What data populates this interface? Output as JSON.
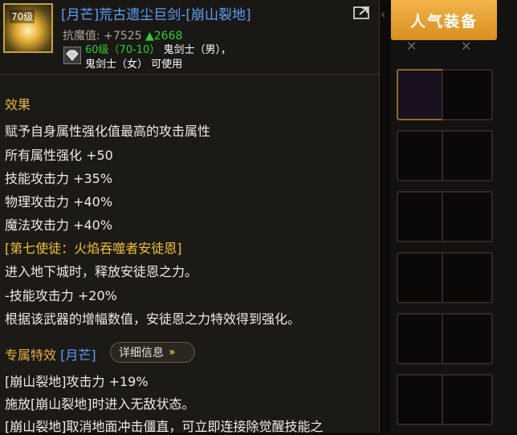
{
  "item": {
    "level_badge": "70级",
    "name": "[月芒]荒古遗尘巨剑-[崩山裂地]",
    "stat_label": "抗魔值: +7525",
    "stat_delta": "▲2668",
    "req_level": "60级（70-10）",
    "req_class_1": "鬼剑士（男），",
    "req_class_2": "鬼剑士（女） 可使用"
  },
  "effect": {
    "title": "效果",
    "lines": [
      "赋予自身属性强化值最高的攻击属性",
      "所有属性强化 +50",
      "技能攻击力 +35%",
      "物理攻击力 +40%",
      "魔法攻击力 +40%"
    ],
    "apostle_title": "[第七使徒：火焰吞噬者安徒恩]",
    "apostle_lines": [
      "进入地下城时，释放安徒恩之力。",
      "-技能攻击力 +20%",
      "根据该武器的增幅数值，安徒恩之力特效得到强化。"
    ]
  },
  "special": {
    "title": "专属特效",
    "tag": "[月芒]",
    "detail_button": "详细信息",
    "lines": [
      "[崩山裂地]攻击力 +19%",
      "施放[崩山裂地]时进入无敌状态。",
      "[崩山裂地]取消地面冲击僵直，可立即连接除觉醒技能之"
    ]
  },
  "side_panel": {
    "hot_button": "人气装备"
  },
  "icons": [
    "share-icon",
    "diamond-icon",
    "chevron-left-icon",
    "double-chevron-icon"
  ]
}
